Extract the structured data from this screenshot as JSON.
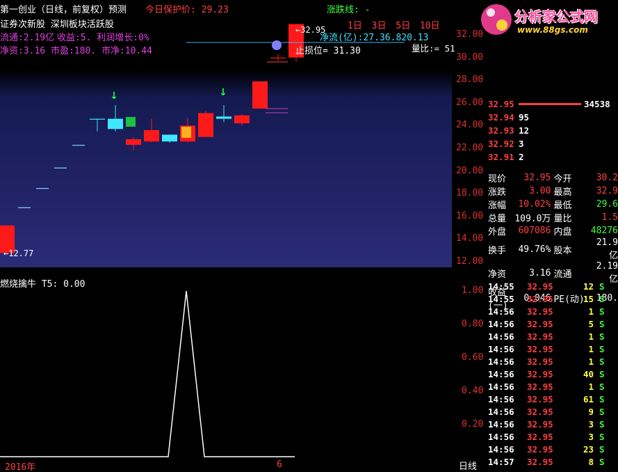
{
  "header": {
    "title": "第一创业（日线，前复权）预测",
    "protect_label": "今日保护价:",
    "protect_value": "29.23",
    "limit_label": "涨跌线:",
    "limit_value": "-"
  },
  "tags": {
    "line1_a": "证券次新股",
    "line1_b": "深圳板块活跃股",
    "line2_a": "流通:2.19亿",
    "line2_b": "收益:5.",
    "line2_c": "利润增长:0%",
    "line3_a": "净资:3.16",
    "line3_b": "市盈:180.",
    "line3_c": "市净:10.44"
  },
  "chart_labels": {
    "periods": [
      "1日",
      "3日",
      "5日",
      "10日"
    ],
    "netflow_label": "净流(亿):",
    "netflow_values": "27.36.820.13",
    "stop_loss": "止损位= 31.30",
    "high_marker": "←32.95",
    "low_marker": "←12.77",
    "vol_ratio": "量比:= 51",
    "sub_title": "燃烧擒牛",
    "sub_value": "T5: 0.00",
    "year_label": "2016年",
    "month_label": "6",
    "period_tab": "日线"
  },
  "logo": {
    "name": "分析家公式网",
    "url": "www.88gs.com"
  },
  "price_axis": [
    "32.00",
    "30.00",
    "28.00",
    "26.00",
    "24.00",
    "22.00",
    "20.00",
    "18.00",
    "16.00",
    "14.00",
    "12.00"
  ],
  "sub_axis": [
    "1.00",
    "0.80",
    "0.60",
    "0.40",
    "0.20"
  ],
  "orderbook": {
    "ask_top": {
      "price": "32.95",
      "volume": "34538"
    },
    "bids": [
      {
        "price": "32.94",
        "volume": "95"
      },
      {
        "price": "32.93",
        "volume": "12"
      },
      {
        "price": "32.92",
        "volume": "3"
      },
      {
        "price": "32.91",
        "volume": "2"
      }
    ]
  },
  "quote": [
    {
      "l1": "现价",
      "v1": "32.95",
      "c1": "red",
      "l2": "今开",
      "v2": "30.2",
      "c2": "red"
    },
    {
      "l1": "涨跌",
      "v1": "3.00",
      "c1": "red",
      "l2": "最高",
      "v2": "32.9",
      "c2": "red"
    },
    {
      "l1": "涨幅",
      "v1": "10.02%",
      "c1": "red",
      "l2": "最低",
      "v2": "29.6",
      "c2": "green"
    },
    {
      "l1": "总量",
      "v1": "109.0万",
      "c1": "white",
      "l2": "量比",
      "v2": "1.5",
      "c2": "red"
    },
    {
      "l1": "外盘",
      "v1": "607086",
      "c1": "red",
      "l2": "内盘",
      "v2": "48276",
      "c2": "green"
    },
    {
      "l1": "换手",
      "v1": "49.76%",
      "c1": "white",
      "l2": "股本",
      "v2": "21.9亿",
      "c2": "white"
    },
    {
      "l1": "净资",
      "v1": "3.16",
      "c1": "white",
      "l2": "流通",
      "v2": "2.19亿",
      "c2": "white"
    },
    {
      "l1": "收益(一)",
      "v1": "0.046",
      "c1": "white",
      "l2": "PE(动)",
      "v2": "180.",
      "c2": "white"
    }
  ],
  "ticks": [
    {
      "t": "14:55",
      "p": "32.95",
      "v": "12",
      "s": "S"
    },
    {
      "t": "14:55",
      "p": "32.95",
      "v": "15",
      "s": "S"
    },
    {
      "t": "14:56",
      "p": "32.95",
      "v": "1",
      "s": "S"
    },
    {
      "t": "14:56",
      "p": "32.95",
      "v": "5",
      "s": "S"
    },
    {
      "t": "14:56",
      "p": "32.95",
      "v": "1",
      "s": "S"
    },
    {
      "t": "14:56",
      "p": "32.95",
      "v": "1",
      "s": "S"
    },
    {
      "t": "14:56",
      "p": "32.95",
      "v": "1",
      "s": "S"
    },
    {
      "t": "14:56",
      "p": "32.95",
      "v": "40",
      "s": "S"
    },
    {
      "t": "14:56",
      "p": "32.95",
      "v": "1",
      "s": "S"
    },
    {
      "t": "14:56",
      "p": "32.95",
      "v": "61",
      "s": "S"
    },
    {
      "t": "14:56",
      "p": "32.95",
      "v": "9",
      "s": "S"
    },
    {
      "t": "14:56",
      "p": "32.95",
      "v": "3",
      "s": "S"
    },
    {
      "t": "14:56",
      "p": "32.95",
      "v": "3",
      "s": "S"
    },
    {
      "t": "14:56",
      "p": "32.95",
      "v": "23",
      "s": "S"
    },
    {
      "t": "14:57",
      "p": "32.95",
      "v": "8",
      "s": "S"
    }
  ],
  "chart_data": {
    "type": "candlestick",
    "ylim": [
      12,
      33
    ],
    "candles": [
      {
        "o": 12.77,
        "c": 15.2,
        "h": 15.2,
        "l": 12.77,
        "up": true
      },
      {
        "o": 16.8,
        "c": 16.8,
        "h": 16.8,
        "l": 16.8,
        "up": true
      },
      {
        "o": 18.5,
        "c": 18.5,
        "h": 18.5,
        "l": 18.5,
        "up": true
      },
      {
        "o": 20.3,
        "c": 20.3,
        "h": 20.3,
        "l": 20.3,
        "up": true
      },
      {
        "o": 22.3,
        "c": 22.3,
        "h": 22.3,
        "l": 22.3,
        "up": true
      },
      {
        "o": 24.6,
        "c": 24.6,
        "h": 24.6,
        "l": 23.5,
        "up": false
      },
      {
        "o": 24.6,
        "c": 23.7,
        "h": 25.8,
        "l": 23.5,
        "up": false
      },
      {
        "o": 22.8,
        "c": 22.3,
        "h": 23.0,
        "l": 21.8,
        "up": true
      },
      {
        "o": 22.6,
        "c": 23.6,
        "h": 24.6,
        "l": 22.5,
        "up": true
      },
      {
        "o": 23.2,
        "c": 22.6,
        "h": 23.2,
        "l": 22.5,
        "up": false
      },
      {
        "o": 22.6,
        "c": 24.0,
        "h": 24.7,
        "l": 22.5,
        "up": true
      },
      {
        "o": 23.0,
        "c": 25.1,
        "h": 25.3,
        "l": 23.0,
        "up": true
      },
      {
        "o": 24.8,
        "c": 24.6,
        "h": 25.8,
        "l": 24.3,
        "up": false
      },
      {
        "o": 24.2,
        "c": 24.9,
        "h": 25.0,
        "l": 24.0,
        "up": true
      },
      {
        "o": 25.5,
        "c": 27.9,
        "h": 27.9,
        "l": 25.5,
        "up": true
      },
      {
        "o": 30.0,
        "c": 30.0,
        "h": 30.3,
        "l": 29.7,
        "up": true
      },
      {
        "o": 30.0,
        "c": 32.95,
        "h": 32.95,
        "l": 29.65,
        "up": true
      }
    ],
    "sub_series": [
      0,
      0,
      0,
      0,
      0,
      0,
      0,
      0,
      0,
      0,
      1,
      0,
      0,
      0,
      0,
      0,
      0
    ],
    "sub_ylim": [
      0,
      1
    ]
  },
  "colors": {
    "up": "#ff1a1a",
    "down": "#40e8ff",
    "axis_red": "#e03030",
    "yellow": "#ffff40"
  }
}
